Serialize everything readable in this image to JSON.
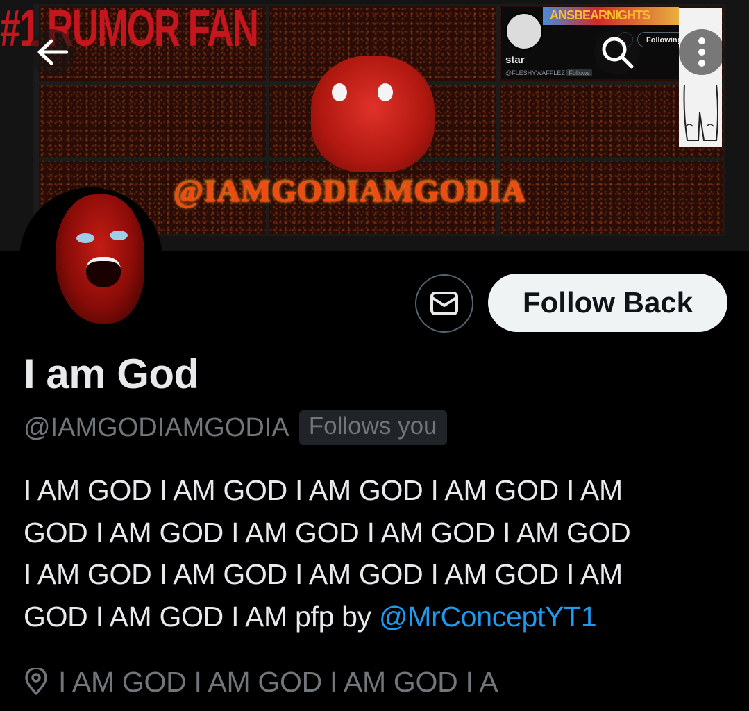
{
  "banner": {
    "top_text": "#1 RUMOR FAN",
    "overlay_handle": "@IAMGODIAMGODIA",
    "mini_card": {
      "top_text": "ANSBEARNIGHTS",
      "name": "star",
      "handle": "@FLESHYWAFFLEZ",
      "follows_badge": "Follows",
      "following_label": "Following"
    }
  },
  "header": {
    "back_icon": "arrow-left-icon",
    "search_icon": "search-icon",
    "more_icon": "more-vertical-icon"
  },
  "profile": {
    "display_name": "I am God",
    "handle": "@IAMGODIAMGODIA",
    "follows_you_badge": "Follows you",
    "bio_lines": [
      "I AM GOD I AM GOD I AM GOD I AM GOD I AM",
      "GOD I AM GOD I AM GOD I AM GOD I AM GOD",
      "I AM GOD I AM GOD I AM GOD I AM GOD I AM"
    ],
    "bio_last_line_text": "GOD I AM GOD I AM pfp by ",
    "bio_mention": "@MrConceptYT1",
    "location": "I AM GOD I AM GOD I AM GOD I A"
  },
  "actions": {
    "message_icon": "envelope-icon",
    "follow_back_label": "Follow Back"
  },
  "colors": {
    "background": "#000000",
    "text_primary": "#e7e9ea",
    "text_secondary": "#71767b",
    "link": "#1d9bf0",
    "button_bg": "#eff3f4"
  }
}
